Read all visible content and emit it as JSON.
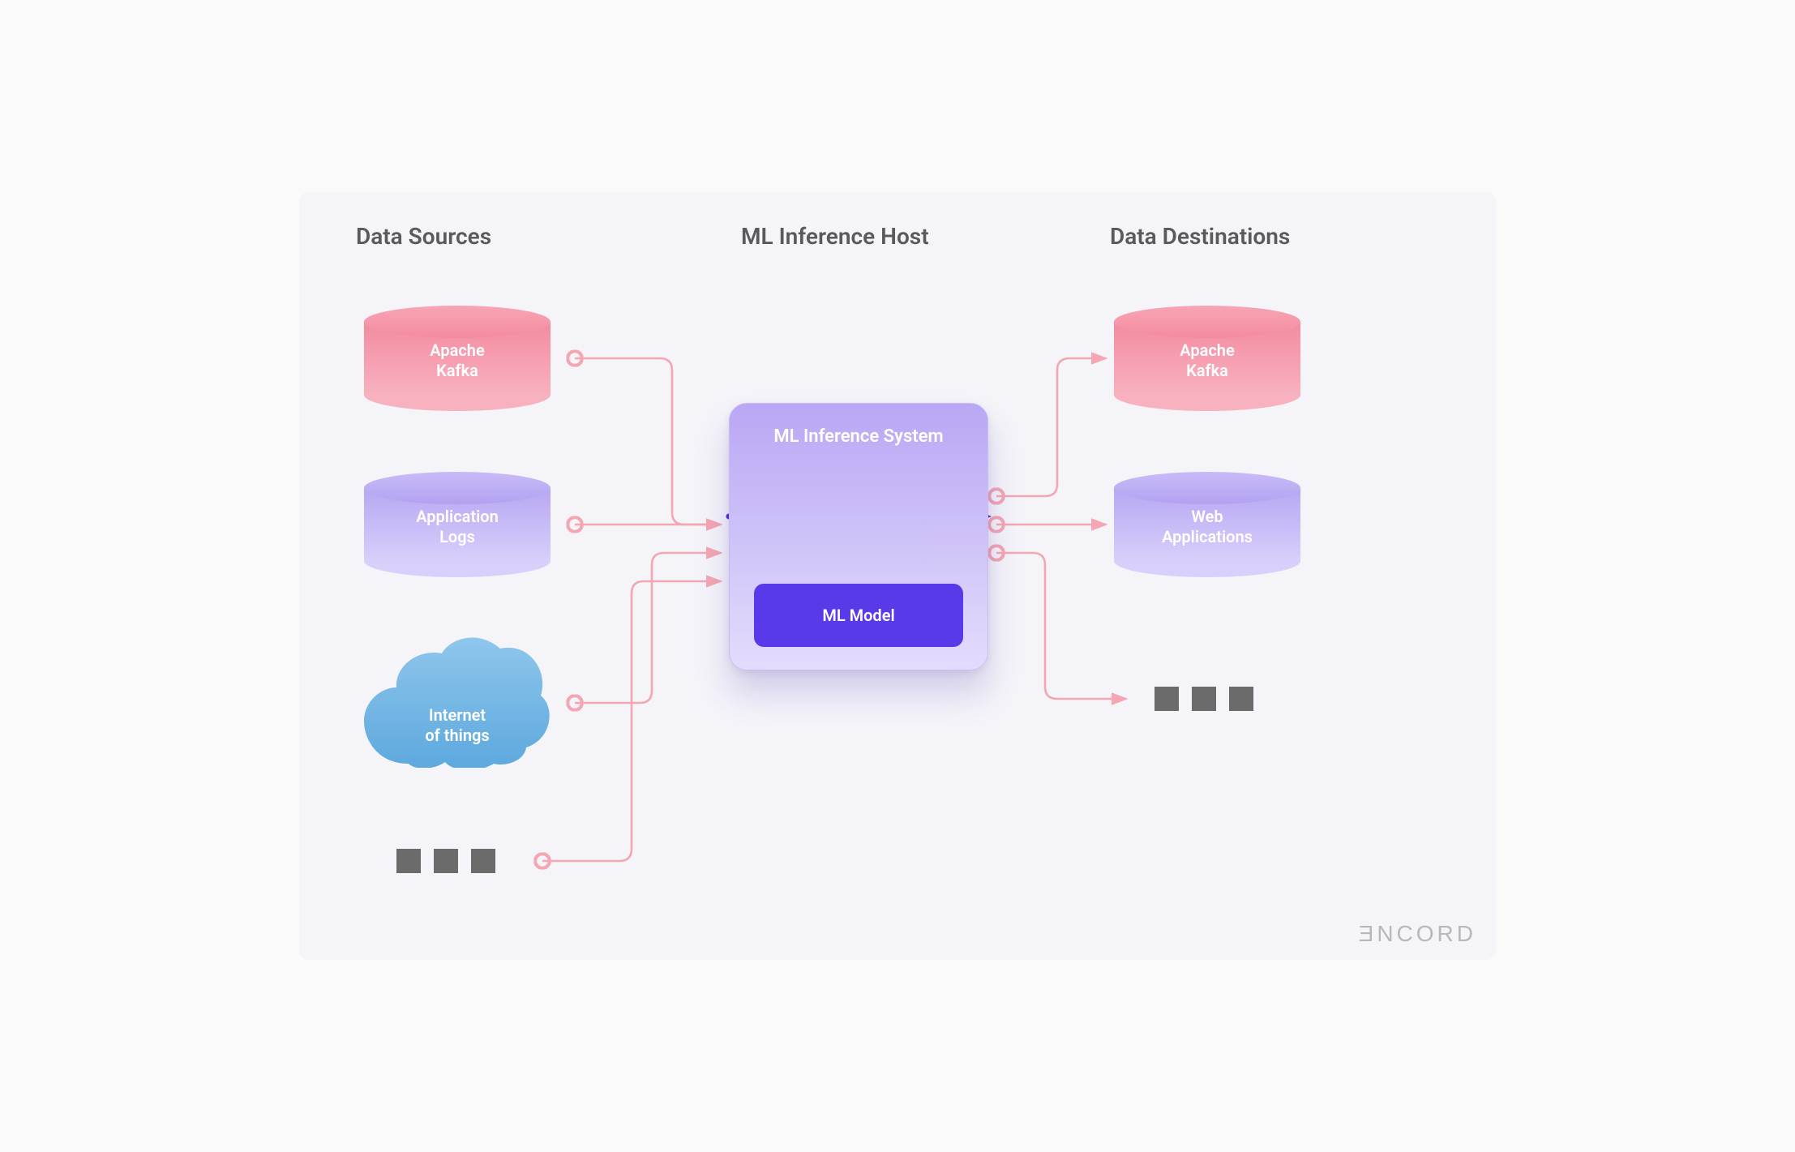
{
  "headings": {
    "sources": "Data Sources",
    "host": "ML Inference Host",
    "destinations": "Data Destinations"
  },
  "sources": {
    "kafka": "Apache\nKafka",
    "logs": "Application\nLogs",
    "iot": "Internet\nof things"
  },
  "host_box": {
    "title": "ML Inference System",
    "model": "ML Model"
  },
  "destinations": {
    "kafka": "Apache\nKafka",
    "web": "Web\nApplications"
  },
  "logo": "ƎNCORD",
  "colors": {
    "pink": "#f48ba0",
    "purple": "#b7a7f3",
    "deep_purple": "#5a3ae8",
    "connector": "#f4a6b2",
    "arrow": "#4b2fd8"
  }
}
